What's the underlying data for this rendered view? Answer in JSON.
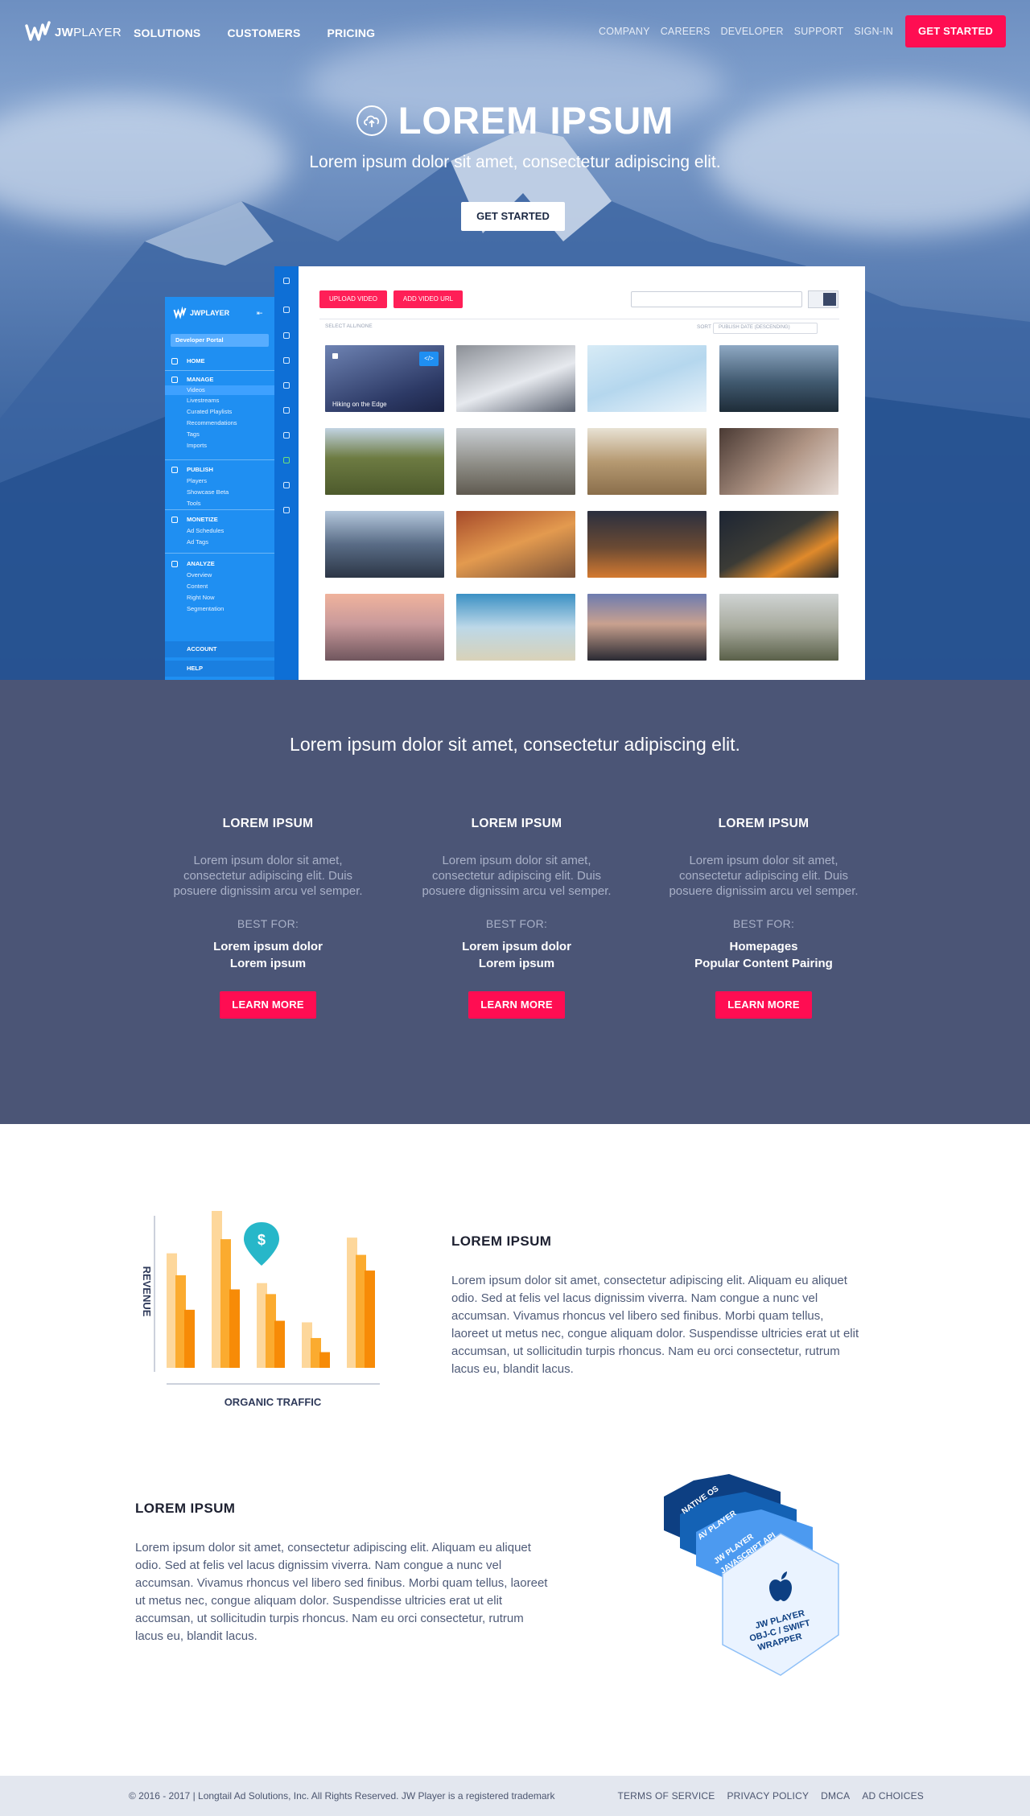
{
  "nav": {
    "logo_bold": "JW",
    "logo_light": "PLAYER",
    "main": [
      "SOLUTIONS",
      "CUSTOMERS",
      "PRICING"
    ],
    "secondary": [
      "COMPANY",
      "CAREERS",
      "DEVELOPER",
      "SUPPORT",
      "SIGN-IN"
    ],
    "cta": "GET STARTED"
  },
  "hero": {
    "title": "LOREM IPSUM",
    "subtitle": "Lorem ipsum dolor sit amet, consectetur adipiscing elit.",
    "button": "GET STARTED"
  },
  "dashboard": {
    "brand": "JWPLAYER",
    "portal": "Developer Portal",
    "sections": [
      {
        "title": "HOME",
        "items": []
      },
      {
        "title": "MANAGE",
        "items": [
          "Videos",
          "Livestreams",
          "Curated Playlists",
          "Recommendations",
          "Tags",
          "Imports"
        ]
      },
      {
        "title": "PUBLISH",
        "items": [
          "Players",
          "Showcase Beta",
          "Tools"
        ]
      },
      {
        "title": "MONETIZE",
        "items": [
          "Ad Schedules",
          "Ad Tags"
        ]
      },
      {
        "title": "ANALYZE",
        "items": [
          "Overview",
          "Content",
          "Right Now",
          "Segmentation"
        ]
      }
    ],
    "account": "ACCOUNT",
    "help": "HELP",
    "upload_button": "UPLOAD VIDEO",
    "add_url_button": "ADD VIDEO URL",
    "select_all": "SELECT ALL/NONE",
    "sort_label": "SORT",
    "sort_value": "PUBLISH DATE (DESCENDING)",
    "first_video_title": "Hiking on the Edge",
    "embed_icon": "</>"
  },
  "features": {
    "lead": "Lorem ipsum dolor sit amet, consectetur adipiscing elit.",
    "columns": [
      {
        "title": "LOREM IPSUM",
        "text": "Lorem ipsum dolor sit amet, consectetur adipiscing elit. Duis posuere dignissim arcu vel semper.",
        "best_for_label": "BEST FOR:",
        "best_for_1": "Lorem ipsum dolor",
        "best_for_2": "Lorem ipsum",
        "button": "LEARN MORE"
      },
      {
        "title": "LOREM IPSUM",
        "text": "Lorem ipsum dolor sit amet, consectetur adipiscing elit. Duis posuere dignissim arcu vel semper.",
        "best_for_label": "BEST FOR:",
        "best_for_1": "Lorem ipsum dolor",
        "best_for_2": "Lorem ipsum",
        "button": "LEARN MORE"
      },
      {
        "title": "LOREM IPSUM",
        "text": "Lorem ipsum dolor sit amet, consectetur adipiscing elit. Duis posuere dignissim arcu vel semper.",
        "best_for_label": "BEST FOR:",
        "best_for_1": "Homepages",
        "best_for_2": "Popular Content Pairing",
        "button": "LEARN MORE"
      }
    ]
  },
  "row1": {
    "title": "LOREM IPSUM",
    "text": "Lorem ipsum dolor sit amet, consectetur adipiscing elit. Aliquam eu aliquet odio. Sed at felis vel lacus dignissim viverra. Nam congue a nunc vel accumsan. Vivamus rhoncus vel libero sed finibus. Morbi quam tellus, laoreet ut metus nec, congue aliquam dolor. Suspendisse ultricies erat ut elit accumsan, ut sollicitudin turpis rhoncus. Nam eu orci consectetur, rutrum lacus eu, blandit lacus."
  },
  "chart_graphic": {
    "y_label": "REVENUE",
    "x_label": "ORGANIC TRAFFIC",
    "pin_symbol": "$",
    "colors": [
      "#fdd79b",
      "#fbab2f",
      "#f78b07"
    ],
    "groups": [
      [
        0.73,
        0.59,
        0.37
      ],
      [
        1.0,
        0.82,
        0.5
      ],
      [
        0.54,
        0.47,
        0.3
      ],
      [
        0.29,
        0.19,
        0.1
      ],
      [
        0.83,
        0.72,
        0.62
      ]
    ]
  },
  "row2": {
    "title": "LOREM IPSUM",
    "text": "Lorem ipsum dolor sit amet, consectetur adipiscing elit. Aliquam eu aliquet odio. Sed at felis vel lacus dignissim viverra. Nam congue a nunc vel accumsan. Vivamus rhoncus vel libero sed finibus. Morbi quam tellus, laoreet ut metus nec, congue aliquam dolor. Suspendisse ultricies erat ut elit accumsan, ut sollicitudin turpis rhoncus. Nam eu orci consectetur, rutrum lacus eu, blandit lacus."
  },
  "hex_stack": {
    "layer1": "NATIVE OS",
    "layer2": "AV PLAYER",
    "layer3a": "JW PLAYER",
    "layer3b": "JAVASCRIPT API",
    "front1": "JW PLAYER",
    "front2": "OBJ-C / SWIFT",
    "front3": "WRAPPER"
  },
  "footer": {
    "copyright": "© 2016 - 2017 | Longtail Ad Solutions, Inc. All Rights Reserved. JW Player is a registered trademark",
    "links": [
      "TERMS OF SERVICE",
      "PRIVACY POLICY",
      "DMCA",
      "AD CHOICES"
    ]
  },
  "colors": {
    "accent_red": "#ff0d52",
    "hero_blue": "#2e5a98",
    "features_bg": "#4b5576",
    "dashboard_blue": "#1f8ff2",
    "footer_bg": "#e3e7ef"
  }
}
